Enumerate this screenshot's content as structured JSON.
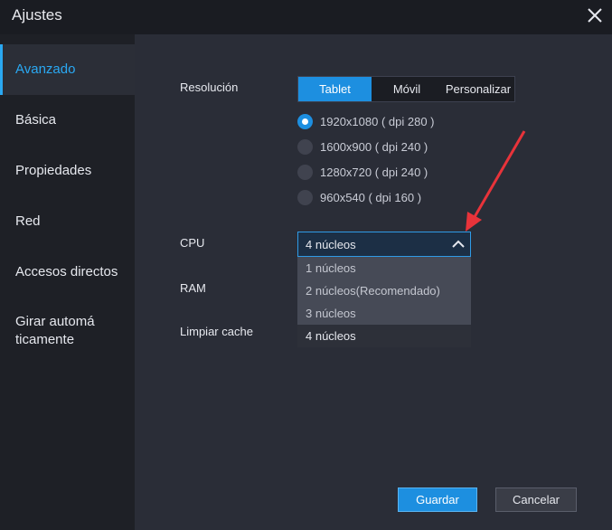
{
  "window": {
    "title": "Ajustes"
  },
  "sidebar": {
    "items": [
      {
        "label": "Avanzado"
      },
      {
        "label": "Básica"
      },
      {
        "label": "Propiedades"
      },
      {
        "label": "Red"
      },
      {
        "label": "Accesos directos"
      },
      {
        "label": "Girar automá ticamente"
      }
    ],
    "active_index": 0
  },
  "resolution": {
    "label": "Resolución",
    "tabs": [
      {
        "label": "Tablet"
      },
      {
        "label": "Móvil"
      },
      {
        "label": "Personalizar"
      }
    ],
    "active_tab": 0,
    "options": [
      {
        "label": "1920x1080 ( dpi 280 )"
      },
      {
        "label": "1600x900 ( dpi 240 )"
      },
      {
        "label": "1280x720 ( dpi 240 )"
      },
      {
        "label": "960x540 ( dpi 160 )"
      }
    ],
    "selected_option": 0
  },
  "cpu": {
    "label": "CPU",
    "value": "4 núcleos",
    "options": [
      {
        "label": "1 núcleos"
      },
      {
        "label": "2 núcleos(Recomendado)"
      },
      {
        "label": "3 núcleos"
      },
      {
        "label": "4 núcleos"
      }
    ],
    "selected_option": 3
  },
  "ram": {
    "label": "RAM"
  },
  "cache": {
    "label": "Limpiar cache"
  },
  "footer": {
    "save_label": "Guardar",
    "cancel_label": "Cancelar"
  },
  "colors": {
    "accent": "#1d8fe0",
    "annotation_arrow": "#e8333a"
  }
}
